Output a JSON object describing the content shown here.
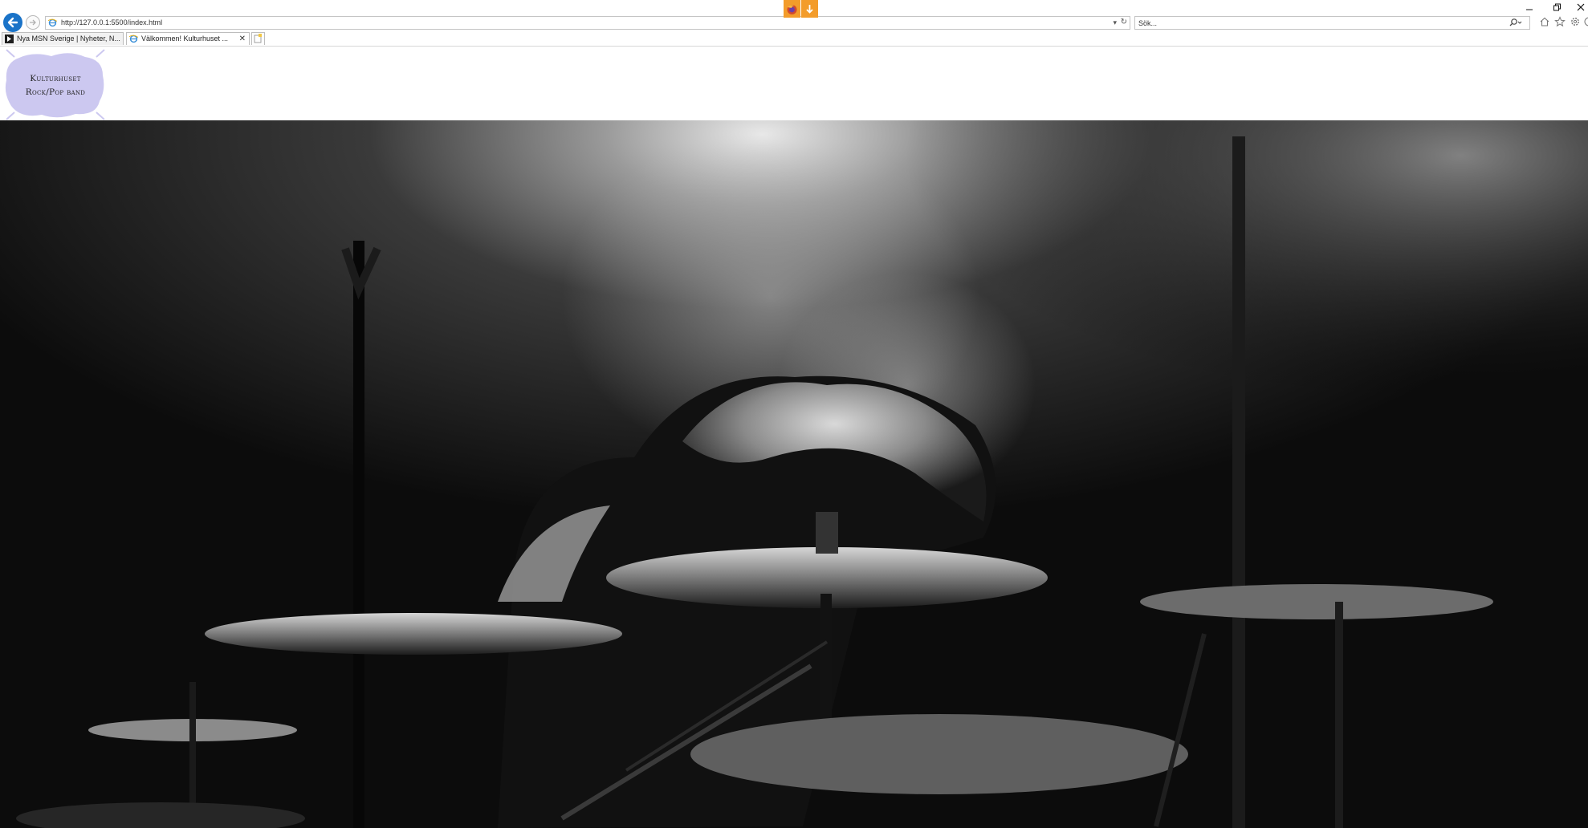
{
  "browser": {
    "address_url": "http://127.0.0.1:5500/index.html",
    "search_placeholder": "Sök...",
    "tabs": [
      {
        "label": "Nya MSN Sverige | Nyheter, N...",
        "active": false
      },
      {
        "label": "Välkommen!   Kulturhuset ...",
        "active": true
      }
    ],
    "toolbar_icons": [
      "back-icon",
      "forward-icon",
      "home-icon",
      "star-icon",
      "gear-icon",
      "smiley-icon"
    ],
    "extensions": [
      "firefox-icon",
      "download-icon"
    ],
    "accent_color": "#1a73c8",
    "extension_color": "#f39c2a"
  },
  "page": {
    "logo": {
      "line1": "Kulturhuset",
      "line2": "Rock/Pop band",
      "blob_color": "#ccc8f0"
    },
    "hero": {
      "subject": "drummer behind cymbals under stage light, black and white photograph"
    }
  }
}
